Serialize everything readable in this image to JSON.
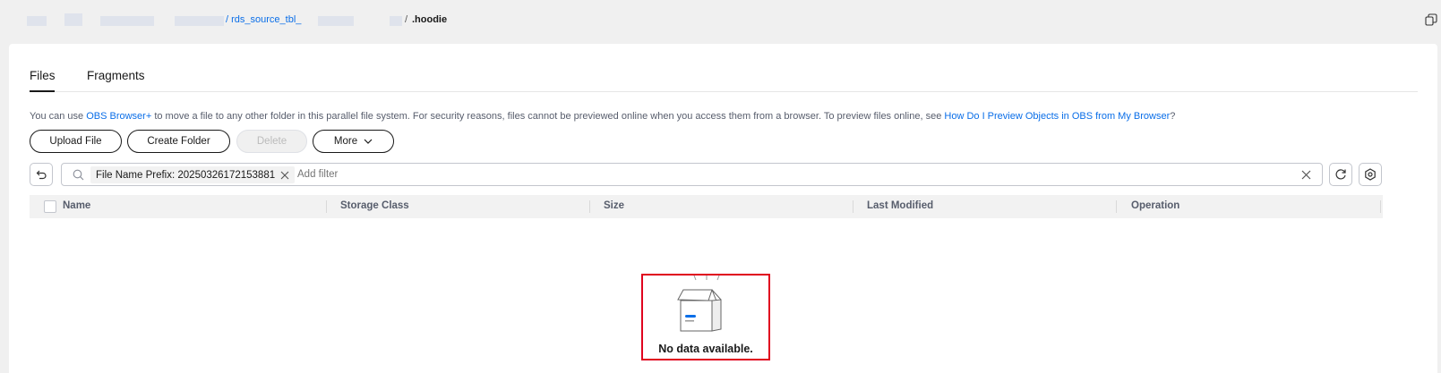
{
  "breadcrumb": {
    "link": "/ rds_source_tbl_",
    "sep": "/",
    "current": ".hoodie"
  },
  "tabs": [
    {
      "label": "Files",
      "active": true
    },
    {
      "label": "Fragments",
      "active": false
    }
  ],
  "notice": {
    "part1": "You can use ",
    "link1": "OBS Browser+",
    "part2": " to move a file to any other folder in this parallel file system. For security reasons, files cannot be previewed online when you access them from a browser. To preview files online, see ",
    "link2": "How Do I Preview Objects in OBS from My Browser",
    "part3": "?"
  },
  "toolbar": {
    "upload": "Upload File",
    "create_folder": "Create Folder",
    "delete": "Delete",
    "more": "More"
  },
  "filter": {
    "tag": "File Name Prefix: 20250326172153881",
    "placeholder": "Add filter"
  },
  "table": {
    "columns": [
      "Name",
      "Storage Class",
      "Size",
      "Last Modified",
      "Operation"
    ]
  },
  "empty": {
    "text": "No data available."
  },
  "colors": {
    "link": "#0a6ee8",
    "highlight_box": "#e0001e"
  }
}
